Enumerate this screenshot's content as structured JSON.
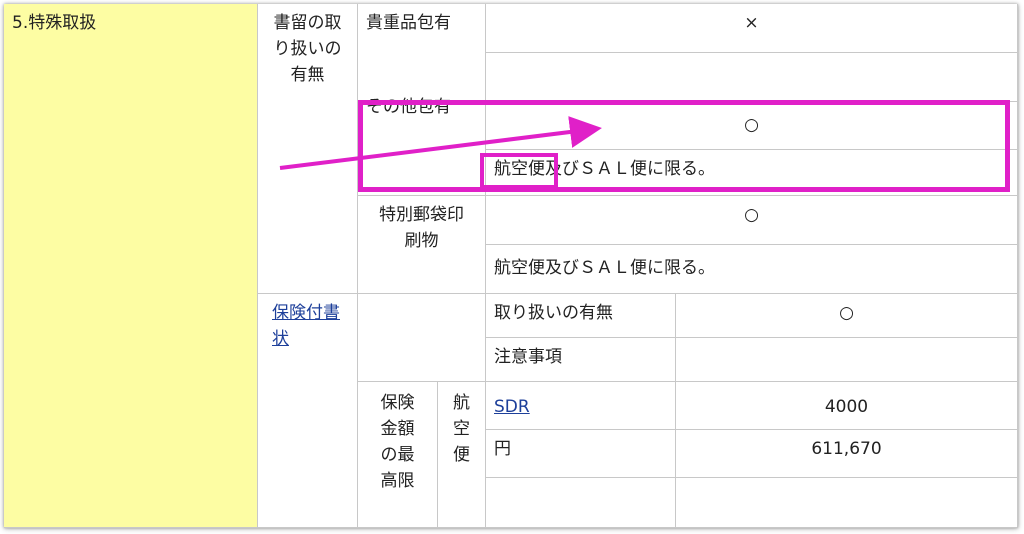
{
  "table": {
    "section_label": "5.特殊取扱",
    "registered": {
      "header": "書留の取り扱いの有無",
      "valuables_label": "貴重品包有",
      "valuables_value": "×",
      "other_label": "その他包有",
      "other_value": "○",
      "other_note": "航空便及びＳＡＬ便に限る。",
      "printed_label": "特別郵袋印刷物",
      "printed_value": "○",
      "printed_note": "航空便及びＳＡＬ便に限る。"
    },
    "insured": {
      "header_link": "保険付書状",
      "handling_label": "取り扱いの有無",
      "handling_value": "○",
      "notes_label": "注意事項",
      "notes_value": "",
      "max_amount_label": "保険金額の最高限",
      "air_label": "航空便",
      "sdr_label": "SDR",
      "sdr_value": "4000",
      "yen_label": "円",
      "yen_value": "611,670"
    }
  },
  "annotation": {
    "color": "#e020c8"
  }
}
